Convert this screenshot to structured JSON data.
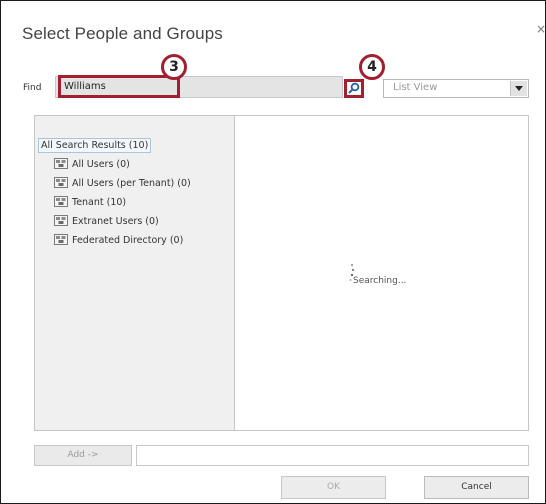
{
  "dialog": {
    "title": "Select People and Groups",
    "close_glyph": "×"
  },
  "find": {
    "label": "Find",
    "value": "Williams"
  },
  "callouts": {
    "find_field": "3",
    "search_button": "4"
  },
  "search_button": {
    "icon": "search-icon"
  },
  "view_select": {
    "selected": "List View"
  },
  "results_tree": {
    "root": "All Search Results (10)",
    "items": [
      {
        "label": "All Users (0)",
        "icon": "directory-icon"
      },
      {
        "label": "All Users (per Tenant) (0)",
        "icon": "directory-icon"
      },
      {
        "label": "Tenant (10)",
        "icon": "directory-icon"
      },
      {
        "label": "Extranet Users (0)",
        "icon": "directory-icon"
      },
      {
        "label": "Federated Directory (0)",
        "icon": "directory-icon"
      }
    ]
  },
  "results_detail": {
    "status": "Searching..."
  },
  "footer": {
    "add_label": "Add ->",
    "ok_label": "OK",
    "cancel_label": "Cancel"
  },
  "colors": {
    "callout_accent": "#a31e2f"
  }
}
